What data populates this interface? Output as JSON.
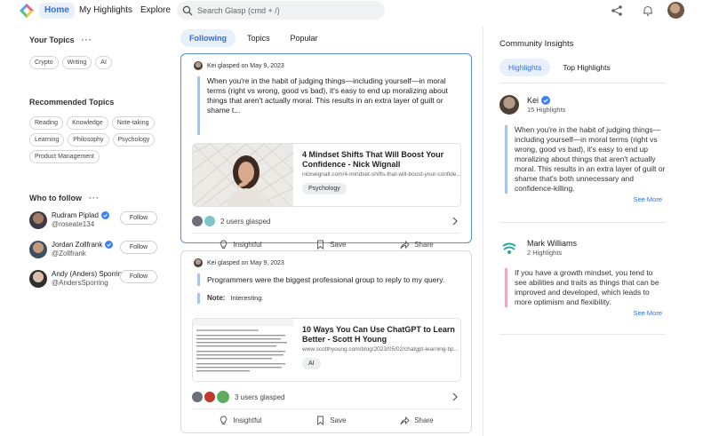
{
  "nav": {
    "home": "Home",
    "highlights": "My Highlights",
    "explore": "Explore",
    "search_placeholder": "Search Glasp (cmd + /)"
  },
  "topics": {
    "title": "Your Topics",
    "items": [
      "Crypto",
      "Writing",
      "AI"
    ]
  },
  "recommended": {
    "title": "Recommended Topics",
    "rows": [
      [
        "Reading",
        "Knowledge",
        "Note-taking"
      ],
      [
        "Learning",
        "Philosophy",
        "Psychology"
      ],
      [
        "Product Management"
      ]
    ]
  },
  "who_to_follow": {
    "title": "Who to follow",
    "follow_label": "Follow",
    "people": [
      {
        "name": "Rudram Piplad",
        "handle": "@roseate134"
      },
      {
        "name": "Jordan Zollfrank",
        "handle": "@Zollfrank"
      },
      {
        "name": "Andy (Anders) Sporring",
        "handle": "@AndersSporring"
      }
    ]
  },
  "feed_tabs": [
    "Following",
    "Topics",
    "Popular"
  ],
  "cards": [
    {
      "header": "Kei glasped on May 9, 2023",
      "quote": "When you're in the habit of judging things—including yourself—in moral terms (right vs wrong, good vs bad), it's easy to end up moralizing about things that aren't actually moral. This results in an extra layer of guilt or shame t...",
      "link_title": "4 Mindset Shifts That Will Boost Your Confidence - Nick Wignall",
      "link_url": "nickwignall.com/4-mindset-shifts-that-will-boost-your-confide...",
      "tag": "Psychology",
      "glasped": "2 users glasped"
    },
    {
      "header": "Kei glasped on May 9, 2023",
      "quote": "Programmers were the biggest professional group to reply to my query.",
      "note_label": "Note:",
      "note_text": "Interesting.",
      "link_title": "10 Ways You Can Use ChatGPT to Learn Better - Scott H Young",
      "link_url": "www.scotthyoung.com/blog/2023/05/02/chatgpt-learning-tip...",
      "tag": "AI",
      "glasped": "3 users glasped"
    }
  ],
  "actions": {
    "insightful": "Insightful",
    "save": "Save",
    "share": "Share"
  },
  "community": {
    "title": "Community Insights",
    "tabs": [
      "Highlights",
      "Top Highlights"
    ],
    "see_more": "See More",
    "items": [
      {
        "name": "Kei",
        "count": "15 Highlights",
        "quote": "When you're in the habit of judging things—including yourself—in moral terms (right vs wrong, good vs bad), it's easy to end up moralizing about things that aren't actually moral. This results in an extra layer of guilt or shame that's both unnecessary and confidence-killing.",
        "bar_color": "#a9c2ee"
      },
      {
        "name": "Mark Williams",
        "count": "2 Highlights",
        "quote": "If you have a growth mindset, you tend to see abilities and traits as things that can be improved and developed, which leads to more optimism and flexibility.",
        "bar_color": "#f0a6c0"
      }
    ]
  },
  "colors": {
    "accent": "#2f6fe0",
    "accent_bg": "#e8f0fc",
    "verified": "#3b82f6"
  }
}
